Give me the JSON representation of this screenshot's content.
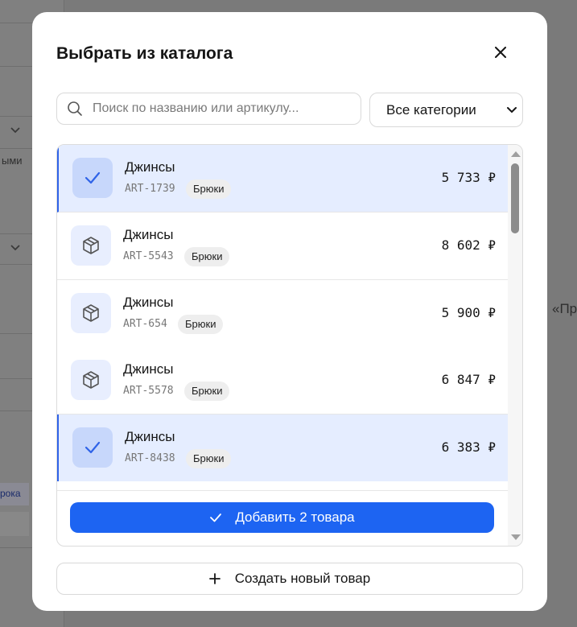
{
  "background": {
    "right_text": "«Пр",
    "link_text": "рока"
  },
  "modal": {
    "title": "Выбрать из каталога",
    "close_icon": "close-icon"
  },
  "search": {
    "placeholder": "Поиск по названию или артикулу...",
    "value": ""
  },
  "category_filter": {
    "selected": "Все категории"
  },
  "products": [
    {
      "name": "Джинсы",
      "sku": "ART-1739",
      "category": "Брюки",
      "price": "5 733 ₽",
      "selected": true
    },
    {
      "name": "Джинсы",
      "sku": "ART-5543",
      "category": "Брюки",
      "price": "8 602 ₽",
      "selected": false
    },
    {
      "name": "Джинсы",
      "sku": "ART-654",
      "category": "Брюки",
      "price": "5 900 ₽",
      "selected": false
    },
    {
      "name": "Джинсы",
      "sku": "ART-5578",
      "category": "Брюки",
      "price": "6 847 ₽",
      "selected": false
    },
    {
      "name": "Джинсы",
      "sku": "ART-8438",
      "category": "Брюки",
      "price": "6 383 ₽",
      "selected": true
    }
  ],
  "actions": {
    "add_label": "Добавить 2 товара",
    "create_label": "Создать новый товар"
  },
  "colors": {
    "accent": "#1d64f2",
    "selected_row": "#e5edff",
    "selected_border": "#2f63e8"
  }
}
